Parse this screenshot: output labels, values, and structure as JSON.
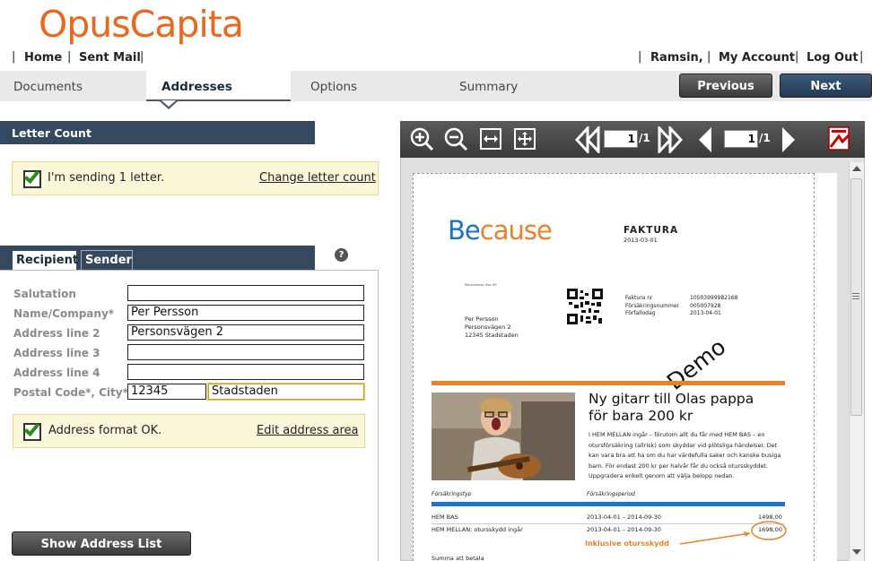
{
  "brand": {
    "logo": "OpusCapita"
  },
  "top_nav": {
    "home": "Home",
    "sent_mail": "Sent Mail",
    "user": "Ramsin,",
    "my_account": "My Account",
    "log_out": "Log Out"
  },
  "steps": {
    "documents": "Documents",
    "addresses": "Addresses",
    "options": "Options",
    "summary": "Summary",
    "active": "Addresses"
  },
  "buttons": {
    "previous": "Previous",
    "next": "Next",
    "show_address_list": "Show Address List"
  },
  "letter_count": {
    "heading": "Letter Count",
    "message": "I'm sending 1 letter.",
    "change_link": "Change letter count"
  },
  "address_tabs": {
    "recipient": "Recipient",
    "sender": "Sender",
    "help": "?"
  },
  "form": {
    "salutation_label": "Salutation",
    "salutation_value": "",
    "name_label": "Name/Company*",
    "name_value": "Per Persson",
    "addr2_label": "Address line 2",
    "addr2_value": "Personsvägen 2",
    "addr3_label": "Address line 3",
    "addr3_value": "",
    "addr4_label": "Address line 4",
    "addr4_value": "",
    "postal_label": "Postal Code*, City*",
    "postal_value": "12345",
    "city_value": "Stadstaden"
  },
  "address_check": {
    "message": "Address format OK.",
    "edit_link": "Edit address area"
  },
  "viewer": {
    "page_current_1": "1",
    "page_total_1": "/1",
    "page_current_2": "1",
    "page_total_2": "/1"
  },
  "document": {
    "brand": "Because",
    "doc_type": "FAKTURA",
    "doc_date": "2013-03-01",
    "return_addr": "Returadress: Box 99",
    "recipient_lines": [
      "Per Persson",
      "Personsvägen 2",
      "12345 Stadstaden"
    ],
    "meta_labels": [
      "Faktura nr",
      "Försäkringsnummer",
      "Förfallodag"
    ],
    "meta_values": [
      "10503999982168",
      "005007928",
      "2013-04-01"
    ],
    "watermark": "Demo",
    "headline": "Ny gitarr till Olas pappa för bara 200 kr",
    "body": "I HEM MELLAN ingår – förutom allt du får med HEM BAS – en otursförsäkring (allrisk) som skyddar vid plötsliga händelser. Det kan vara bra att ha om du har värdefulla saker och kanske busiga barn. För endast 200 kr per halvår får du också otursskyddet. Uppgradera enkelt genom att välja belopp nedan.",
    "table_head": [
      "Försäkringstyp",
      "Försäkringsperiod"
    ],
    "rows": [
      {
        "type": "HEM BAS",
        "period": "2013-04-01 – 2014-09-30",
        "amount": "1498,00"
      },
      {
        "type": "HEM MELLAN: otursskydd ingår",
        "period": "2013-04-01 – 2014-09-30",
        "amount": "1698,00"
      }
    ],
    "callout": "Inklusive otursskydd",
    "footer_partial": "Summa att betala"
  },
  "icons": [
    "zoom-in-icon",
    "zoom-out-icon",
    "fit-width-icon",
    "fit-page-icon",
    "first-page-icon",
    "last-page-icon",
    "prev-page-icon",
    "next-page-icon",
    "pdf-icon"
  ],
  "colors": {
    "accent_orange": "#e8681e",
    "header_dark": "#34495e",
    "notice_bg": "#fbf7d9"
  }
}
